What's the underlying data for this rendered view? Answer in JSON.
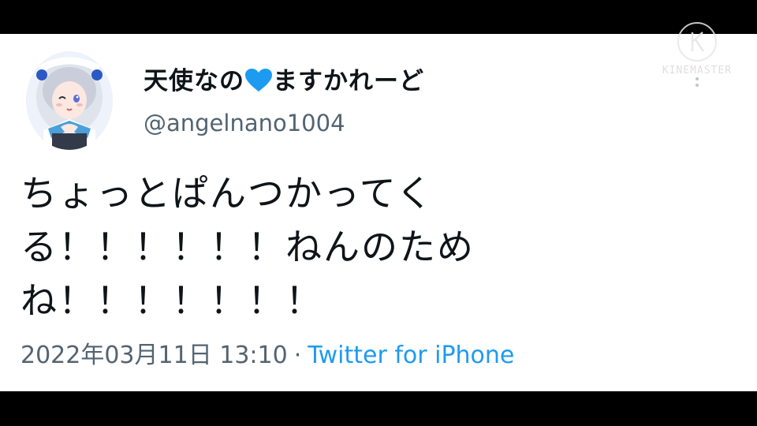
{
  "tweet": {
    "display_name_before": "天使なの",
    "display_name_after": "ますかれーど",
    "heart_emoji_color": "#1d9bf0",
    "handle": "@angelnano1004",
    "text_lines": [
      "ちょっとぱんつかってく",
      "る！！！！！！ねんのため",
      "ね！！！！！！！"
    ],
    "timestamp": "2022年03月11日 13:10",
    "separator": "·",
    "source": "Twitter for iPhone",
    "source_color": "#1d9bf0"
  },
  "watermark": {
    "label": "KINEMASTER",
    "icon": "kinemaster-logo-icon"
  },
  "colors": {
    "background": "#000000",
    "card": "#ffffff",
    "primary_text": "#0f1419",
    "secondary_text": "#536471",
    "accent": "#1d9bf0"
  }
}
